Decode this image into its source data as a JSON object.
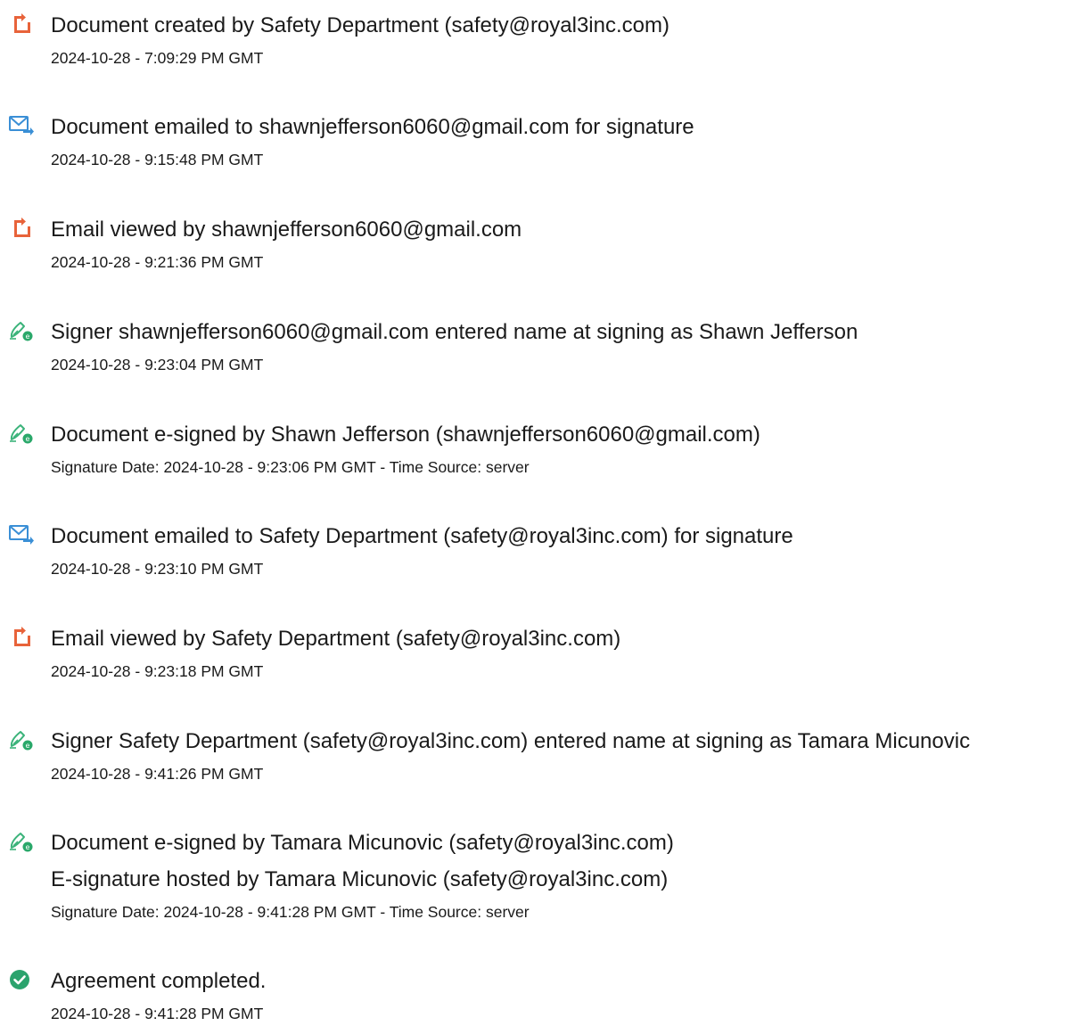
{
  "colors": {
    "pdf_icon": "#e8633a",
    "email_icon": "#3a8fd6",
    "sign_icon_pen": "#3bb37a",
    "sign_icon_badge": "#2aa86a",
    "complete_icon": "#2ba36d",
    "text": "#1a1a1a"
  },
  "events": [
    {
      "icon": "document-icon",
      "lines": [
        "Document created by Safety Department (safety@royal3inc.com)"
      ],
      "meta": "2024-10-28 - 7:09:29 PM GMT"
    },
    {
      "icon": "email-icon",
      "lines": [
        "Document emailed to shawnjefferson6060@gmail.com for signature"
      ],
      "meta": "2024-10-28 - 9:15:48 PM GMT"
    },
    {
      "icon": "document-icon",
      "lines": [
        "Email viewed by shawnjefferson6060@gmail.com"
      ],
      "meta": "2024-10-28 - 9:21:36 PM GMT"
    },
    {
      "icon": "signature-icon",
      "lines": [
        "Signer shawnjefferson6060@gmail.com entered name at signing as Shawn Jefferson"
      ],
      "meta": "2024-10-28 - 9:23:04 PM GMT"
    },
    {
      "icon": "signature-icon",
      "lines": [
        "Document e-signed by Shawn Jefferson (shawnjefferson6060@gmail.com)"
      ],
      "meta": "Signature Date: 2024-10-28 - 9:23:06 PM GMT - Time Source: server"
    },
    {
      "icon": "email-icon",
      "lines": [
        "Document emailed to Safety Department (safety@royal3inc.com) for signature"
      ],
      "meta": "2024-10-28 - 9:23:10 PM GMT"
    },
    {
      "icon": "document-icon",
      "lines": [
        "Email viewed by Safety Department (safety@royal3inc.com)"
      ],
      "meta": "2024-10-28 - 9:23:18 PM GMT"
    },
    {
      "icon": "signature-icon",
      "lines": [
        "Signer Safety Department (safety@royal3inc.com) entered name at signing as Tamara Micunovic"
      ],
      "meta": "2024-10-28 - 9:41:26 PM GMT"
    },
    {
      "icon": "signature-icon",
      "lines": [
        "Document e-signed by Tamara Micunovic (safety@royal3inc.com)",
        "E-signature hosted by Tamara Micunovic (safety@royal3inc.com)"
      ],
      "meta": "Signature Date: 2024-10-28 - 9:41:28 PM GMT - Time Source: server"
    },
    {
      "icon": "check-circle-icon",
      "lines": [
        "Agreement completed."
      ],
      "meta": "2024-10-28 - 9:41:28 PM GMT"
    }
  ]
}
